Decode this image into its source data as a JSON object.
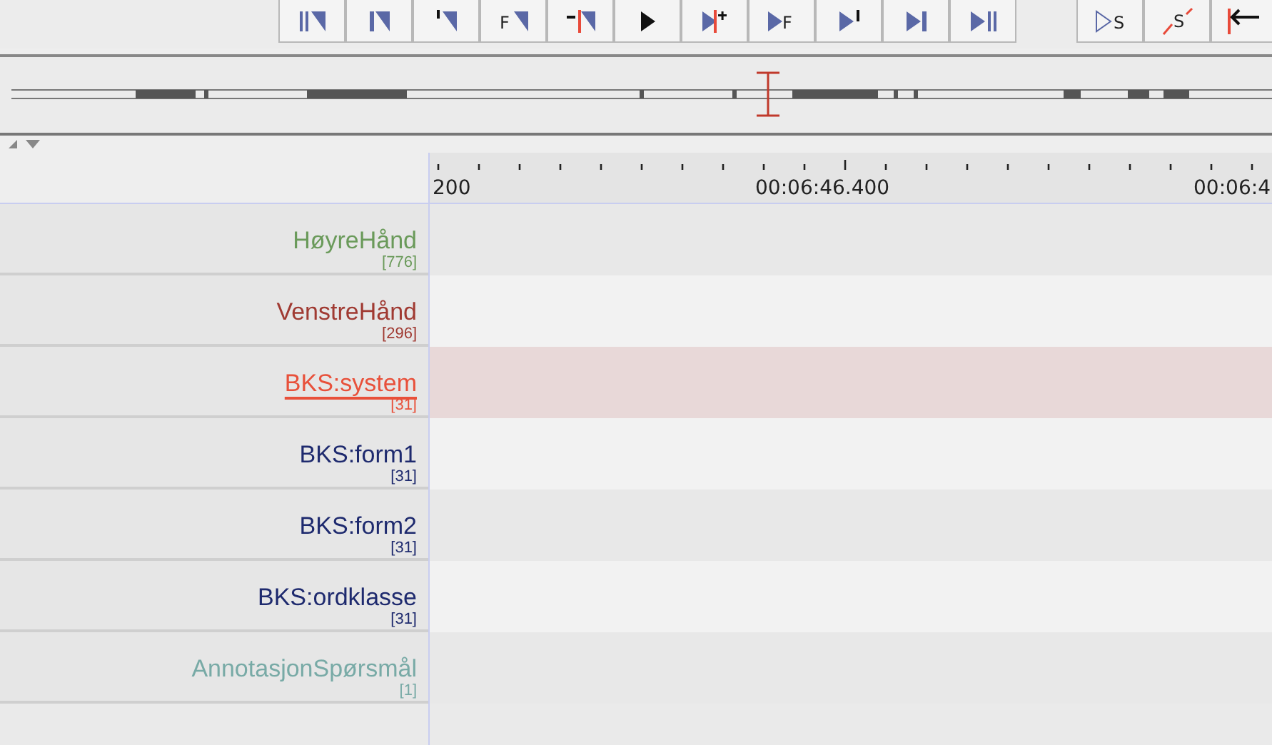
{
  "toolbar": {
    "buttons": [
      {
        "kind": "bars-left"
      },
      {
        "kind": "bar-left"
      },
      {
        "kind": "tick-left"
      },
      {
        "kind": "letter-left",
        "glyph": "F"
      },
      {
        "kind": "red-left"
      },
      {
        "kind": "play"
      },
      {
        "kind": "play-red"
      },
      {
        "kind": "letter-right",
        "glyph": "F"
      },
      {
        "kind": "tick-right"
      },
      {
        "kind": "bar-right"
      },
      {
        "kind": "bars-right"
      },
      {
        "kind": "gap"
      },
      {
        "kind": "letter-outline",
        "glyph": "S"
      },
      {
        "kind": "letter-struck",
        "glyph": "S"
      },
      {
        "kind": "red-arrow"
      }
    ]
  },
  "ruler": {
    "labels": [
      "200",
      "00:06:46.400",
      "00:06:4"
    ]
  },
  "tiers": [
    {
      "name": "HøyreHånd",
      "count": "[776]",
      "color": "#6a9a5a",
      "selected": false
    },
    {
      "name": "VenstreHånd",
      "count": "[296]",
      "color": "#a03a32",
      "selected": false
    },
    {
      "name": "BKS:system",
      "count": "[31]",
      "color": "#e8503a",
      "selected": true
    },
    {
      "name": "BKS:form1",
      "count": "[31]",
      "color": "#1e2a6e",
      "selected": false
    },
    {
      "name": "BKS:form2",
      "count": "[31]",
      "color": "#1e2a6e",
      "selected": false
    },
    {
      "name": "BKS:ordklasse",
      "count": "[31]",
      "color": "#1e2a6e",
      "selected": false
    },
    {
      "name": "AnnotasjonSpørsmål",
      "count": "[1]",
      "color": "#78aaa6",
      "selected": false
    }
  ]
}
